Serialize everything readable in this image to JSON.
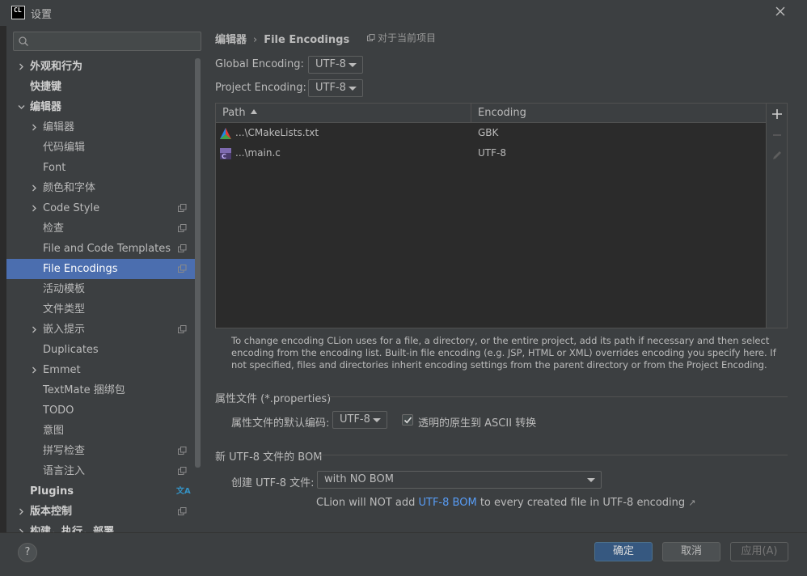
{
  "window": {
    "app_icon_text": "CL",
    "title": "设置"
  },
  "search": {
    "placeholder": ""
  },
  "tree": [
    {
      "label": "外观和行为",
      "indent": 0,
      "chevron": "right",
      "bold": true,
      "proj": false,
      "selected": false
    },
    {
      "label": "快捷键",
      "indent": 0,
      "chevron": "none",
      "bold": true,
      "proj": false,
      "selected": false
    },
    {
      "label": "编辑器",
      "indent": 0,
      "chevron": "down",
      "bold": true,
      "proj": false,
      "selected": false
    },
    {
      "label": "编辑器",
      "indent": 1,
      "chevron": "right",
      "bold": false,
      "proj": false,
      "selected": false
    },
    {
      "label": "代码编辑",
      "indent": 1,
      "chevron": "none",
      "bold": false,
      "proj": false,
      "selected": false
    },
    {
      "label": "Font",
      "indent": 1,
      "chevron": "none",
      "bold": false,
      "proj": false,
      "selected": false
    },
    {
      "label": "颜色和字体",
      "indent": 1,
      "chevron": "right",
      "bold": false,
      "proj": false,
      "selected": false
    },
    {
      "label": "Code Style",
      "indent": 1,
      "chevron": "right",
      "bold": false,
      "proj": true,
      "selected": false
    },
    {
      "label": "检查",
      "indent": 1,
      "chevron": "none",
      "bold": false,
      "proj": true,
      "selected": false
    },
    {
      "label": "File and Code Templates",
      "indent": 1,
      "chevron": "none",
      "bold": false,
      "proj": true,
      "selected": false
    },
    {
      "label": "File Encodings",
      "indent": 1,
      "chevron": "none",
      "bold": false,
      "proj": true,
      "selected": true
    },
    {
      "label": "活动模板",
      "indent": 1,
      "chevron": "none",
      "bold": false,
      "proj": false,
      "selected": false
    },
    {
      "label": "文件类型",
      "indent": 1,
      "chevron": "none",
      "bold": false,
      "proj": false,
      "selected": false
    },
    {
      "label": "嵌入提示",
      "indent": 1,
      "chevron": "right",
      "bold": false,
      "proj": true,
      "selected": false
    },
    {
      "label": "Duplicates",
      "indent": 1,
      "chevron": "none",
      "bold": false,
      "proj": false,
      "selected": false
    },
    {
      "label": "Emmet",
      "indent": 1,
      "chevron": "right",
      "bold": false,
      "proj": false,
      "selected": false
    },
    {
      "label": "TextMate 捆绑包",
      "indent": 1,
      "chevron": "none",
      "bold": false,
      "proj": false,
      "selected": false
    },
    {
      "label": "TODO",
      "indent": 1,
      "chevron": "none",
      "bold": false,
      "proj": false,
      "selected": false
    },
    {
      "label": "意图",
      "indent": 1,
      "chevron": "none",
      "bold": false,
      "proj": false,
      "selected": false
    },
    {
      "label": "拼写检查",
      "indent": 1,
      "chevron": "none",
      "bold": false,
      "proj": true,
      "selected": false
    },
    {
      "label": "语言注入",
      "indent": 1,
      "chevron": "none",
      "bold": false,
      "proj": true,
      "selected": false
    },
    {
      "label": "Plugins",
      "indent": 0,
      "chevron": "none",
      "bold": true,
      "proj": false,
      "translate": true,
      "selected": false
    },
    {
      "label": "版本控制",
      "indent": 0,
      "chevron": "right",
      "bold": true,
      "proj": true,
      "selected": false
    },
    {
      "label": "构建，执行，部署",
      "indent": 0,
      "chevron": "right",
      "bold": true,
      "proj": false,
      "selected": false
    }
  ],
  "breadcrumb": {
    "parent": "编辑器",
    "separator": "›",
    "current": "File Encodings",
    "scope_hint": "对于当前项目"
  },
  "global_encoding": {
    "label": "Global Encoding:",
    "value": "UTF-8"
  },
  "project_encoding": {
    "label": "Project Encoding:",
    "value": "UTF-8"
  },
  "table": {
    "columns": [
      "Path",
      "Encoding"
    ],
    "rows": [
      {
        "path": "...\\CMakeLists.txt",
        "encoding": "GBK",
        "icon": "cmake-icon"
      },
      {
        "path": "...\\main.c",
        "encoding": "UTF-8",
        "icon": "c-file-icon"
      }
    ]
  },
  "hint": "To change encoding CLion uses for a file, a directory, or the entire project, add its path if necessary and then select encoding from the encoding list. Built-in file encoding (e.g. JSP, HTML or XML) overrides encoding you specify here. If not specified, files and directories inherit encoding settings from the parent directory or from the Project Encoding.",
  "properties": {
    "title": "属性文件 (*.properties)",
    "default_label": "属性文件的默认编码:",
    "default_value": "UTF-8",
    "ascii_label": "透明的原生到 ASCII 转换",
    "ascii_checked": true
  },
  "bom": {
    "title": "新 UTF-8 文件的 BOM",
    "create_label": "创建 UTF-8 文件:",
    "create_value": "with NO BOM",
    "note_prefix": "CLion will NOT add",
    "note_link": "UTF-8 BOM",
    "note_suffix": "to every created file in UTF-8 encoding",
    "note_arrow": "↗"
  },
  "footer": {
    "help": "?",
    "ok": "确定",
    "cancel": "取消",
    "apply": "应用(A)"
  },
  "colors": {
    "selection": "#4b6eaf",
    "link": "#589df6",
    "primary_button": "#365880"
  }
}
